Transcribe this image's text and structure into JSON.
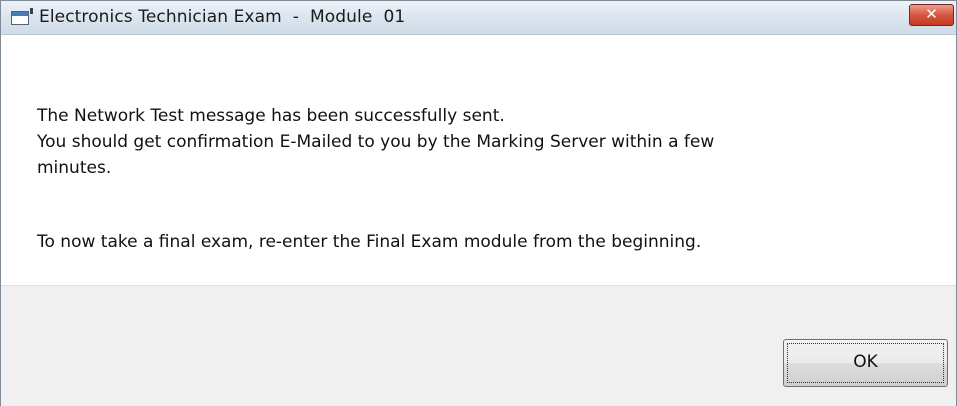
{
  "window": {
    "title": "Electronics Technician Exam  -  Module  01",
    "close_label": "✕",
    "icon": "application-window-icon"
  },
  "message": {
    "lines": [
      "The Network Test message has been successfully sent.",
      "You should get confirmation E-Mailed to you by the Marking Server within a few",
      "minutes.",
      "To now take a final exam, re-enter the Final Exam module from the beginning."
    ]
  },
  "buttons": {
    "ok_label": "OK"
  },
  "colors": {
    "close_button": "#d9553e",
    "footer_background": "#f0f0f0"
  }
}
